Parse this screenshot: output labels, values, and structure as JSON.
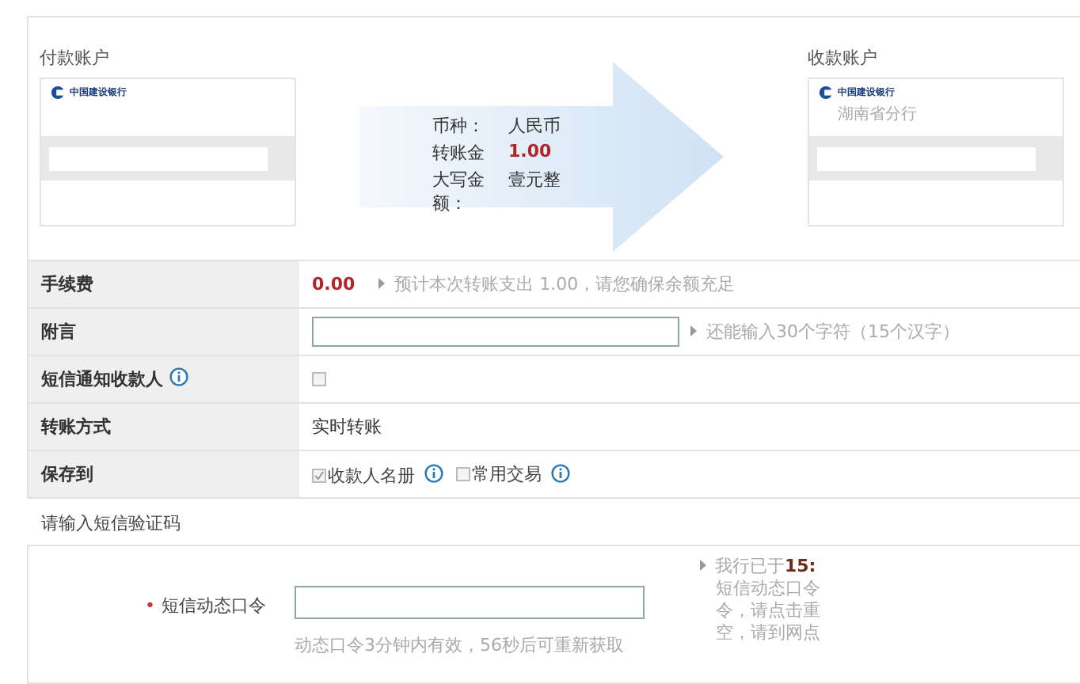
{
  "payer": {
    "label": "付款账户",
    "bank": "中国建设银行"
  },
  "summary": [
    {
      "label": "币种：",
      "value": "人民币",
      "kind": "plain"
    },
    {
      "label": "转账金",
      "value": "1.00",
      "kind": "amount"
    },
    {
      "label": "大写金额：",
      "value": "壹元整",
      "kind": "plain"
    }
  ],
  "payee": {
    "label": "收款账户",
    "bank": "中国建设银行",
    "branch": "湖南省分行"
  },
  "rows": [
    {
      "kind": "fee",
      "label": "手续费",
      "value": "0.00",
      "hint": "预计本次转账支出 1.00，请您确保余额充足"
    },
    {
      "kind": "input",
      "label": "附言",
      "hint": "还能输入30个字符（15个汉字）"
    },
    {
      "kind": "checkbox",
      "label": "短信通知收款人",
      "info": true,
      "checked": false
    },
    {
      "kind": "text",
      "label": "转账方式",
      "value": "实时转账"
    },
    {
      "kind": "options",
      "label": "保存到",
      "options": [
        {
          "label": "收款人名册",
          "checked": true
        },
        {
          "label": "常用交易",
          "checked": false
        }
      ]
    }
  ],
  "sms": {
    "title": "请输入短信验证码",
    "label": "短信动态口令",
    "required": "•",
    "hint": "动态口令3分钟内有效，56秒后可重新获取",
    "notice": [
      {
        "text": "我行已于",
        "time": "15:"
      },
      {
        "text": "短信动态口令"
      },
      {
        "text": "令，请点击重"
      },
      {
        "text": "空，请到网点"
      }
    ]
  }
}
